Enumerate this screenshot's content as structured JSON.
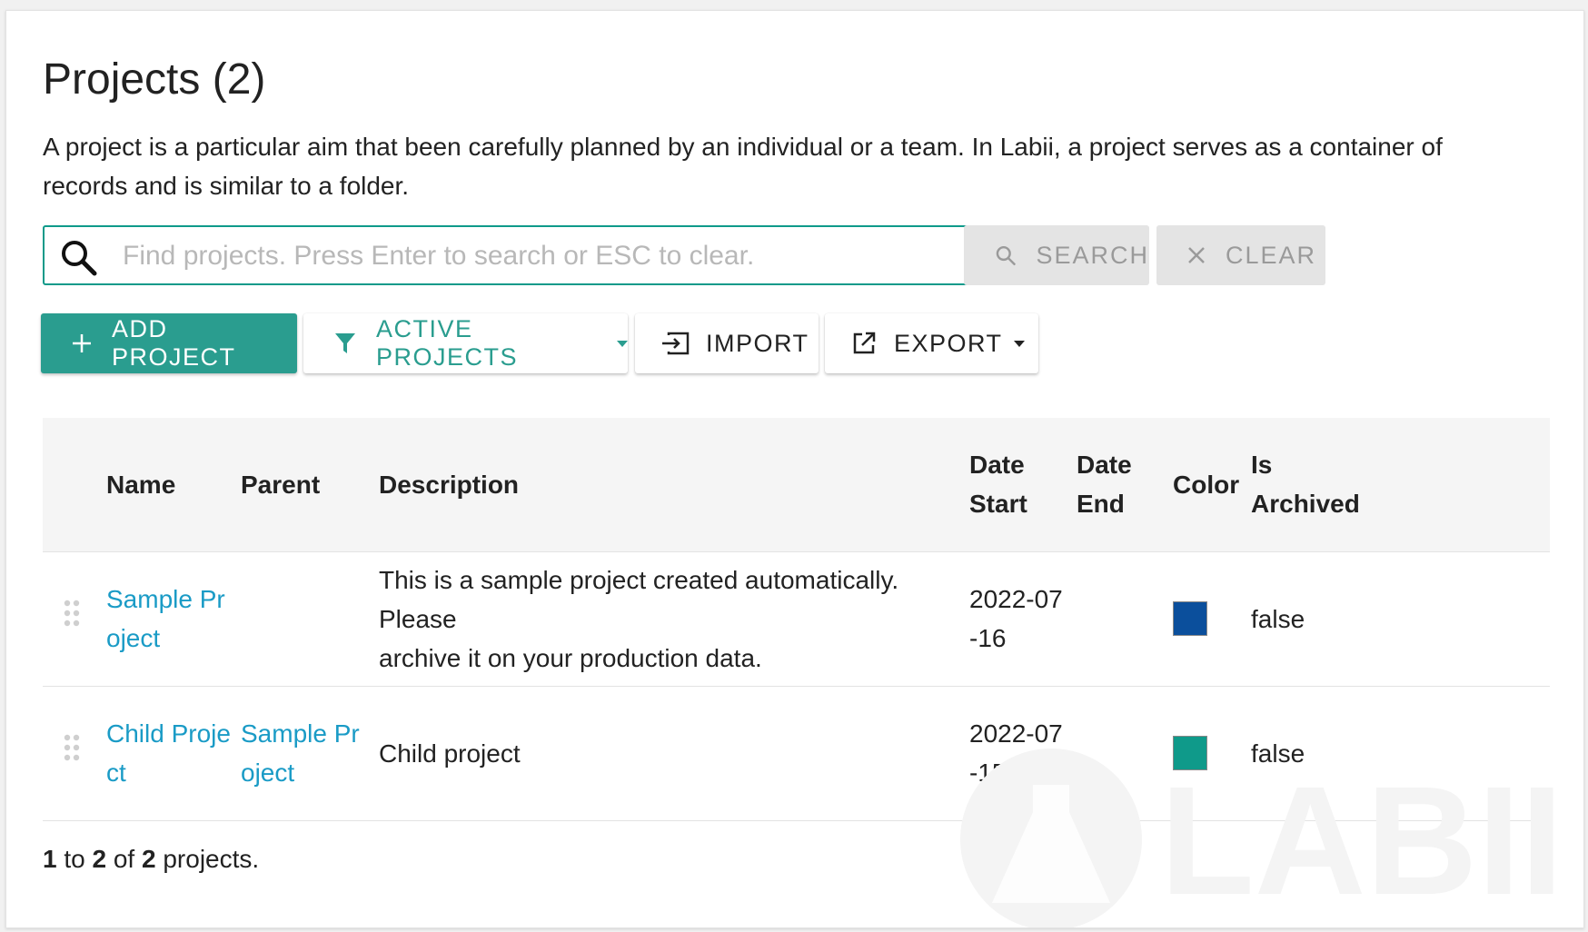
{
  "page": {
    "title": "Projects (2)",
    "description": "A project is a particular aim that been carefully planned by an individual or a team. In Labii, a project serves as a container of records and is similar to a folder."
  },
  "search": {
    "placeholder": "Find projects. Press Enter to search or ESC to clear.",
    "value": "",
    "search_label": "SEARCH",
    "clear_label": "CLEAR"
  },
  "toolbar": {
    "add_label": "ADD PROJECT",
    "filter_label": "ACTIVE PROJECTS",
    "import_label": "IMPORT",
    "export_label": "EXPORT"
  },
  "table": {
    "headers": {
      "name": "Name",
      "parent": "Parent",
      "description": "Description",
      "date_start_1": "Date",
      "date_start_2": "Start",
      "date_end_1": "Date",
      "date_end_2": "End",
      "color": "Color",
      "archived_1": "Is",
      "archived_2": "Archived"
    },
    "rows": [
      {
        "name_1": "Sample Pr",
        "name_2": "oject",
        "parent_1": "",
        "parent_2": "",
        "description_1": "This is a sample project created automatically. Please",
        "description_2": "archive it on your production data.",
        "date_start_1": "2022-07",
        "date_start_2": "-16",
        "date_end": "",
        "color": "#0b4f9c",
        "is_archived": "false"
      },
      {
        "name_1": "Child Proje",
        "name_2": "ct",
        "parent_1": "Sample Pr",
        "parent_2": "oject",
        "description_1": "Child project",
        "description_2": "",
        "date_start_1": "2022-07",
        "date_start_2": "-15",
        "date_end": "",
        "color": "#0f9a8a",
        "is_archived": "false"
      }
    ]
  },
  "footer": {
    "from": "1",
    "to_word": "to",
    "to": "2",
    "of_word": "of",
    "total": "2",
    "suffix": "projects."
  },
  "colors": {
    "accent": "#2a9d8f",
    "link": "#1a9bc6"
  },
  "watermark": {
    "text": "LABII"
  }
}
